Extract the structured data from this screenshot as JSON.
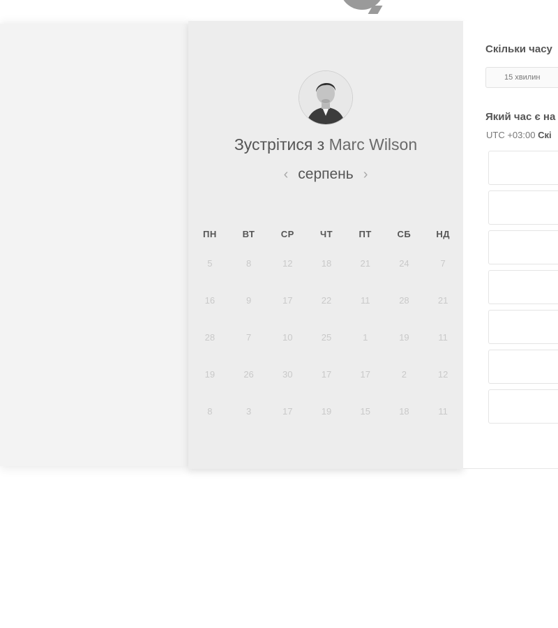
{
  "booking": {
    "title_prefix": "Зустрітися з",
    "host_name": "Marc Wilson",
    "month": "серпень",
    "prev_icon": "chevron-left-icon",
    "next_icon": "chevron-right-icon"
  },
  "calendar": {
    "weekdays": [
      "ПН",
      "ВТ",
      "СР",
      "ЧТ",
      "ПТ",
      "СБ",
      "НД"
    ],
    "days": [
      [
        "5",
        "8",
        "12",
        "18",
        "21",
        "24",
        "7"
      ],
      [
        "16",
        "9",
        "17",
        "22",
        "11",
        "28",
        "21"
      ],
      [
        "28",
        "7",
        "10",
        "25",
        "1",
        "19",
        "11"
      ],
      [
        "19",
        "26",
        "30",
        "17",
        "17",
        "2",
        "12"
      ],
      [
        "8",
        "3",
        "17",
        "19",
        "15",
        "18",
        "11"
      ]
    ]
  },
  "panel": {
    "duration_question": "Скільки часу",
    "duration_value": "15 хвилин",
    "time_question": "Який час є на",
    "timezone_label": "UTC +03:00",
    "timezone_suffix": "Скі",
    "slots": [
      "",
      "",
      "",
      "",
      "",
      "",
      ""
    ]
  },
  "colors": {
    "card_bg": "#ededed",
    "left_bg": "#f3f3f3",
    "text_dark": "#555555",
    "day_muted": "#c9c9c9"
  }
}
